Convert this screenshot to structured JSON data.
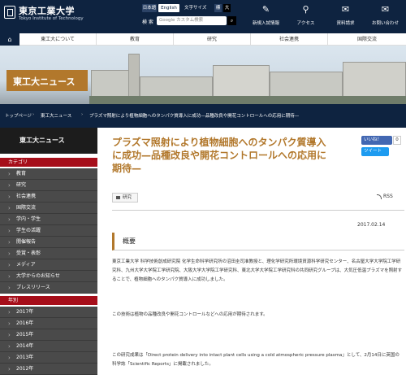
{
  "header": {
    "univ_name": "東京工業大学",
    "univ_en": "Tokyo Institute of Technology",
    "lang": [
      "日本語",
      "English"
    ],
    "text_size_label": "文字サイズ",
    "text_sizes": [
      "標",
      "大"
    ],
    "search_label": "検 索",
    "search_placeholder": "Google カスタム検索",
    "quick_links": [
      {
        "label": "新規入試情報",
        "icon": "pen-icon"
      },
      {
        "label": "アクセス",
        "icon": "location-pin-icon"
      },
      {
        "label": "資料請求",
        "icon": "envelope-icon"
      },
      {
        "label": "お問い合わせ",
        "icon": "mail-icon"
      }
    ]
  },
  "nav": {
    "items": [
      "東工大について",
      "教育",
      "研究",
      "社会連携",
      "国際交流"
    ]
  },
  "hero": {
    "title": "東工大ニュース"
  },
  "breadcrumb": {
    "items": [
      "トップページ",
      "東工大ニュース",
      "プラズマ照射により植物細胞へのタンパク質導入に成功—品種改良や開花コントロールへの応用に期待—"
    ]
  },
  "sidebar": {
    "title": "東工大ニュース",
    "category_label": "カテゴリ",
    "categories": [
      "教育",
      "研究",
      "社会連携",
      "国際交流",
      "学内・学生",
      "学生の活躍",
      "開催報告",
      "受賞・表彰",
      "メディア",
      "大学からのお知らせ",
      "プレスリリース"
    ],
    "year_label": "年別",
    "years": [
      "2017年",
      "2016年",
      "2015年",
      "2014年",
      "2013年",
      "2012年"
    ]
  },
  "article": {
    "title": "プラズマ照射により植物細胞へのタンパク質導入に成功—品種改良や開花コントロールへの応用に期待—",
    "like_label": "いいね！",
    "like_count": "0",
    "tweet_label": "ツイート",
    "tag": "研究",
    "rss_label": "RSS",
    "date": "2017.02.14",
    "summary_heading": "概要",
    "paragraphs": [
      "東京工業大学 科学技術創成研究院 化学生命科学研究所の沼田圭司准教授と、理化学研究所環境資源科学研究センター、名古屋大学大学院工学研究科、九州大学大学院工学研究院、大阪大学大学院工学研究科、東北大学大学院工学研究科の共同研究グループは、大気圧低温プラズマを照射することで、植物細胞へのタンパク質導入に成功しました。",
      "この技術は植物の品種改良や開花コントロールなどへの応用が期待されます。",
      "この研究成果は「Direct protein delivery into intact plant cells using a cold atmospheric pressure plasma」として、2月14日に英国の科学誌「Scientific Reports」に掲載されました。"
    ]
  }
}
